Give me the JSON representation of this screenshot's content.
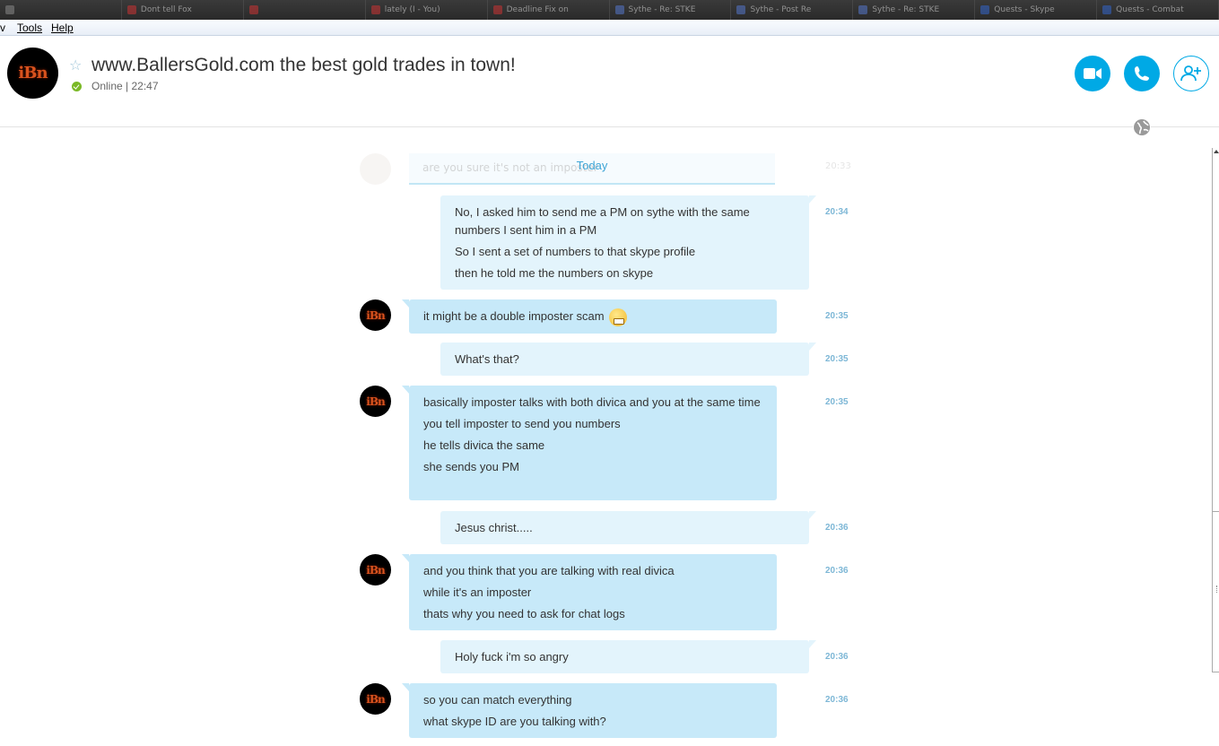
{
  "taskbar": {
    "items": [
      {
        "label": "",
        "color": "#888"
      },
      {
        "label": "Dont tell Fox",
        "color": "#c33"
      },
      {
        "label": "",
        "color": "#c33"
      },
      {
        "label": "lately (I - You)",
        "color": "#c33"
      },
      {
        "label": "Deadline Fix on",
        "color": "#c33"
      },
      {
        "label": "Sythe - Re: STKE",
        "color": "#5577cc"
      },
      {
        "label": "Sythe - Post Re",
        "color": "#5577cc"
      },
      {
        "label": "Sythe - Re: STKE",
        "color": "#5577cc"
      },
      {
        "label": "Quests - Skype",
        "color": "#3366cc"
      },
      {
        "label": "Quests - Combat",
        "color": "#3366cc"
      }
    ]
  },
  "menu": {
    "view_partial": "v",
    "tools": "Tools",
    "help": "Help"
  },
  "contact": {
    "name": "www.BallersGold.com the best gold trades in town!",
    "status": "Online",
    "separator": "|",
    "local_time": "22:47",
    "avatar_text": "iBn"
  },
  "header_actions": {
    "video_icon": "video-call-icon",
    "call_icon": "phone-icon",
    "add_icon": "add-contact-icon"
  },
  "chat": {
    "ghost_text": "are you sure it's not an imposter",
    "ghost_time": "20:33",
    "today_label": "Today",
    "messages": [
      {
        "dir": "out",
        "time": "20:34",
        "lines": [
          "No, I asked him to send me a PM on sythe with the same numbers I sent him in a PM",
          "So I sent a set of numbers to that skype profile",
          "then he told me the numbers on skype"
        ]
      },
      {
        "dir": "in",
        "time": "20:35",
        "lines": [
          "it might be a double imposter scam"
        ],
        "emoticon": "grimace-emoji"
      },
      {
        "dir": "out",
        "time": "20:35",
        "lines": [
          "What's that?"
        ]
      },
      {
        "dir": "in",
        "time": "20:35",
        "lines": [
          "basically imposter talks with both divica and you at the same time",
          "you tell imposter to send you numbers",
          "he tells divica the same",
          "she sends you PM"
        ]
      },
      {
        "dir": "out",
        "time": "20:36",
        "lines": [
          "Jesus christ....."
        ]
      },
      {
        "dir": "in",
        "time": "20:36",
        "lines": [
          "and you think that you are talking with real divica",
          "while it's an imposter",
          "thats why you need to ask for chat logs"
        ]
      },
      {
        "dir": "out",
        "time": "20:36",
        "lines": [
          "Holy fuck i'm so angry"
        ]
      },
      {
        "dir": "in",
        "time": "20:36",
        "lines": [
          "so you can match everything",
          "what skype ID are you talking with?"
        ]
      }
    ]
  },
  "colors": {
    "accent": "#00a9e5",
    "incoming_bubble": "#c7e9f9",
    "outgoing_bubble": "#e3f4fc",
    "online": "#7bb927"
  }
}
